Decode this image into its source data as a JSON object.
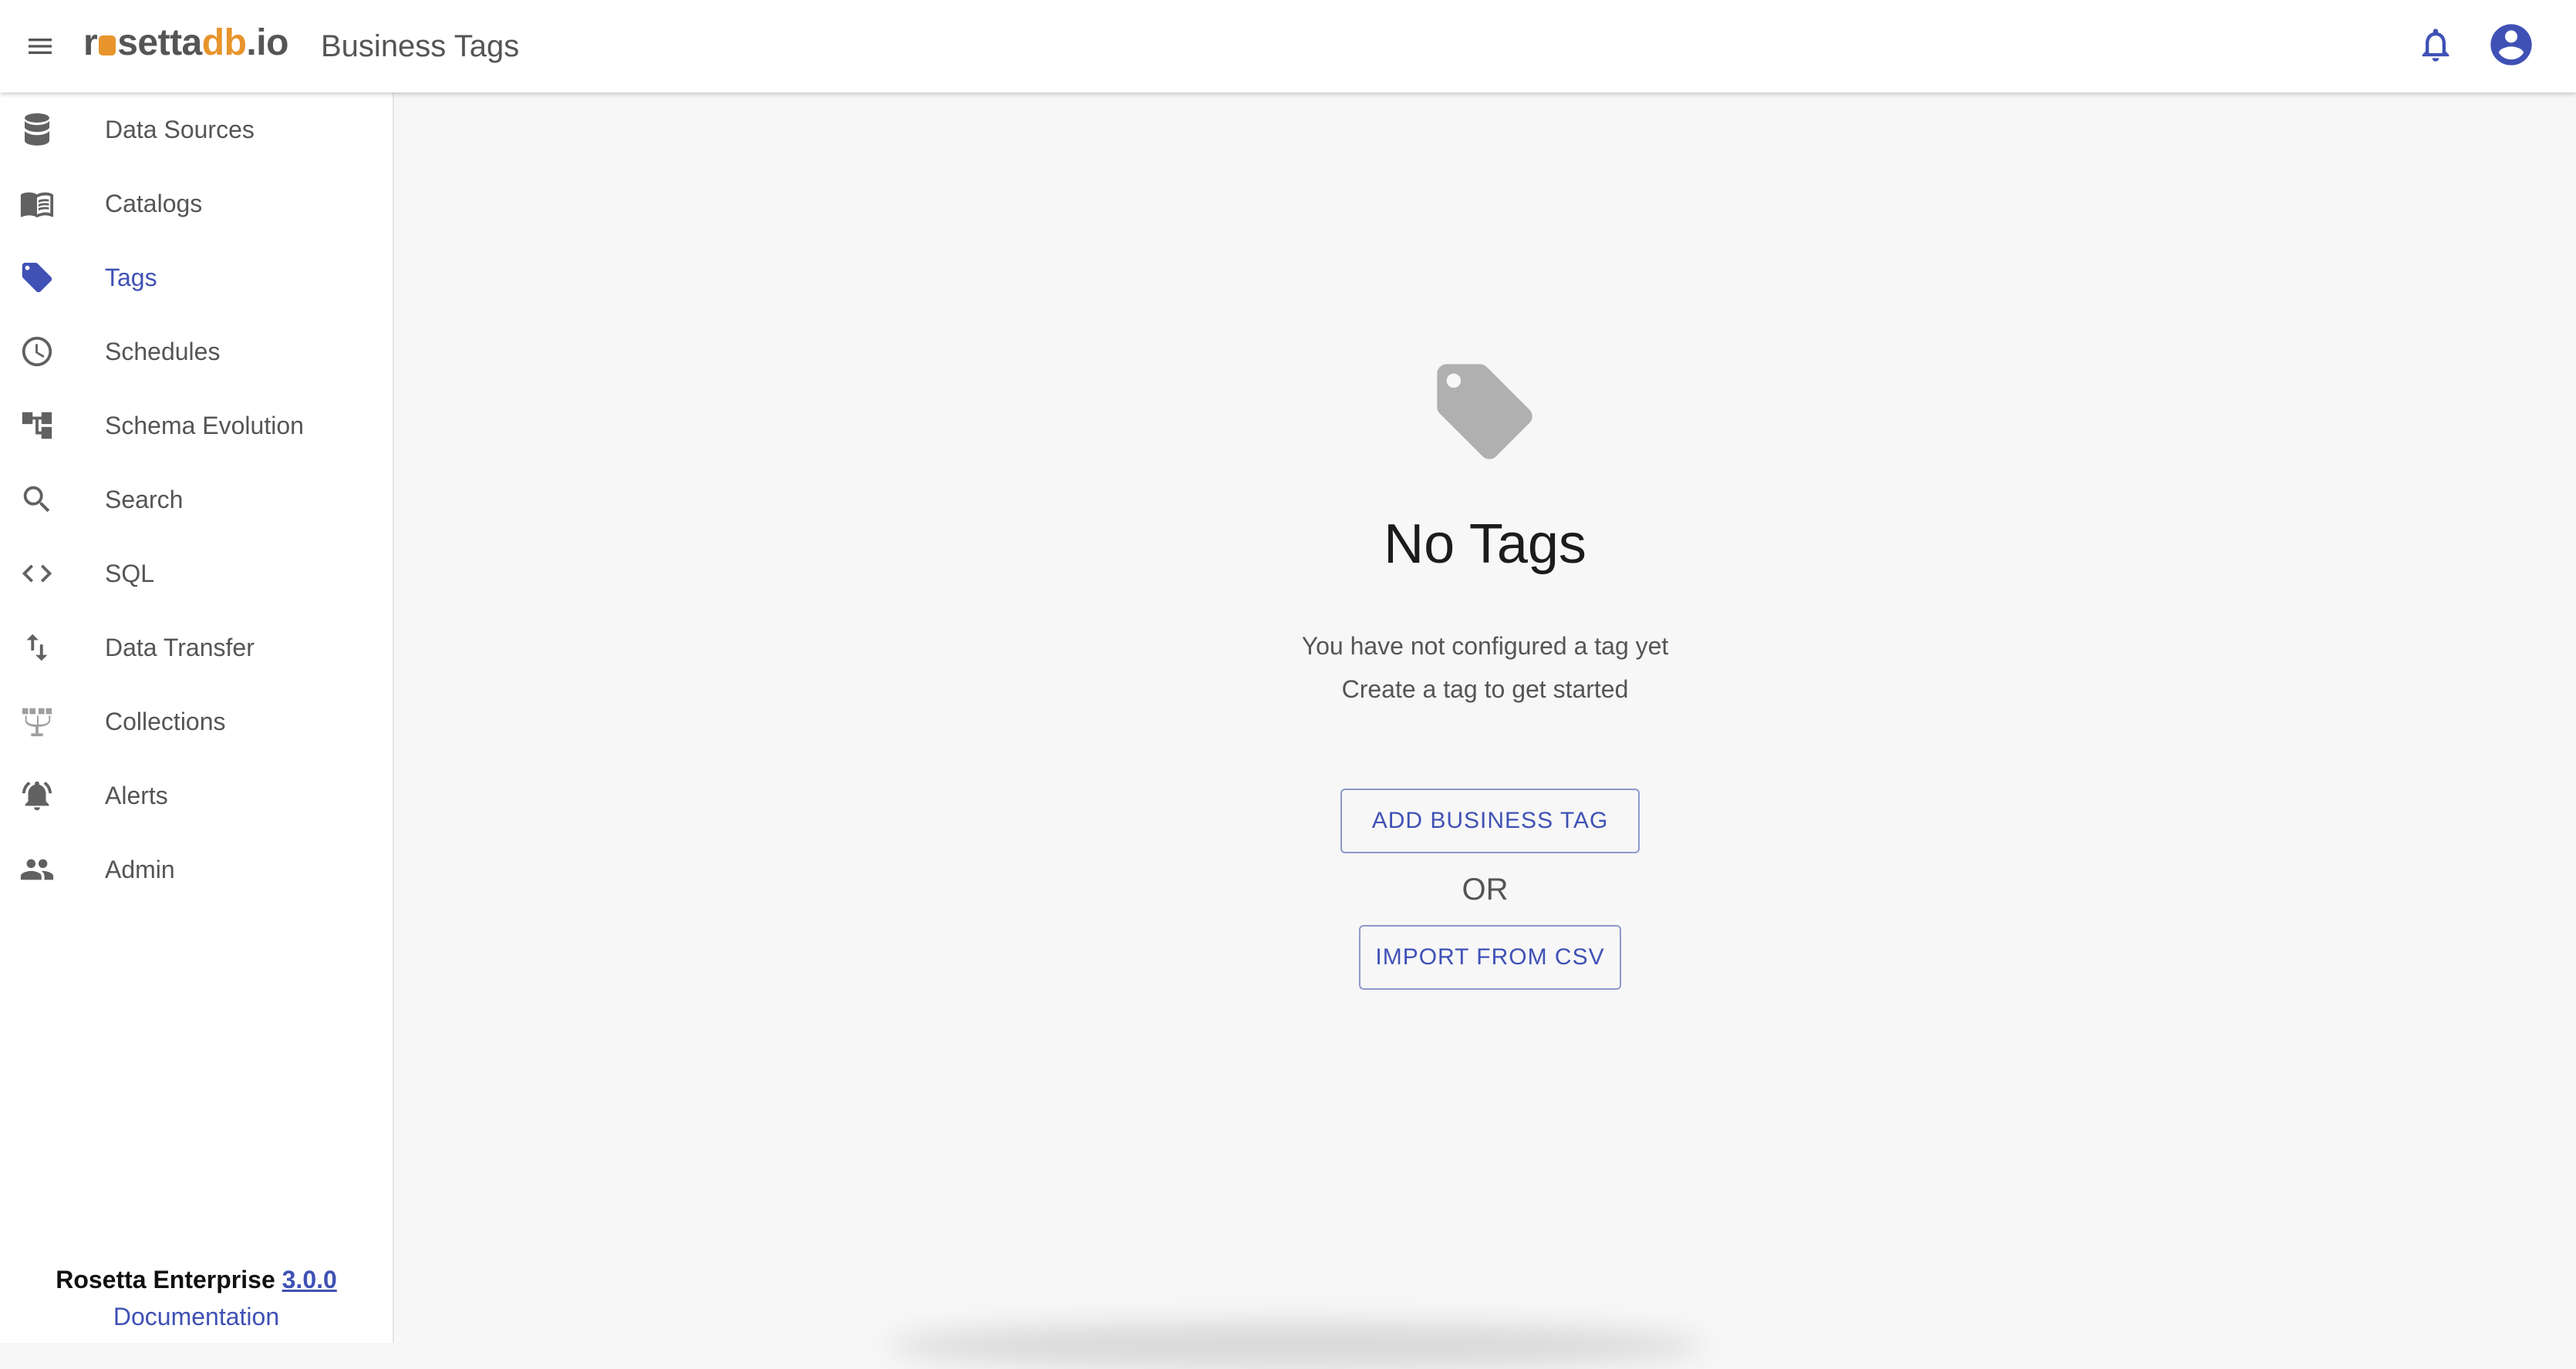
{
  "header": {
    "logo_prefix": "r",
    "logo_middle": "setta",
    "logo_db": "db",
    "logo_suffix": ".io",
    "title": "Business Tags"
  },
  "sidebar": {
    "items": [
      {
        "label": "Data Sources",
        "icon": "database-icon"
      },
      {
        "label": "Catalogs",
        "icon": "book-icon"
      },
      {
        "label": "Tags",
        "icon": "tag-icon",
        "active": true
      },
      {
        "label": "Schedules",
        "icon": "clock-icon"
      },
      {
        "label": "Schema Evolution",
        "icon": "schema-tree-icon"
      },
      {
        "label": "Search",
        "icon": "search-icon"
      },
      {
        "label": "SQL",
        "icon": "code-icon"
      },
      {
        "label": "Data Transfer",
        "icon": "swap-vertical-icon"
      },
      {
        "label": "Collections",
        "icon": "collections-icon"
      },
      {
        "label": "Alerts",
        "icon": "alert-bell-icon"
      },
      {
        "label": "Admin",
        "icon": "people-icon"
      }
    ],
    "footer": {
      "product": "Rosetta Enterprise",
      "version": "3.0.0",
      "documentation": "Documentation"
    }
  },
  "main": {
    "empty_title": "No Tags",
    "empty_line1": "You have not configured a tag yet",
    "empty_line2": "Create a tag to get started",
    "add_button": "ADD BUSINESS TAG",
    "or_text": "OR",
    "import_button": "IMPORT FROM CSV"
  },
  "colors": {
    "accent": "#3f51b5",
    "icon_grey": "#616161",
    "brand_orange": "#e8942c",
    "empty_icon": "#b0b0b0"
  }
}
